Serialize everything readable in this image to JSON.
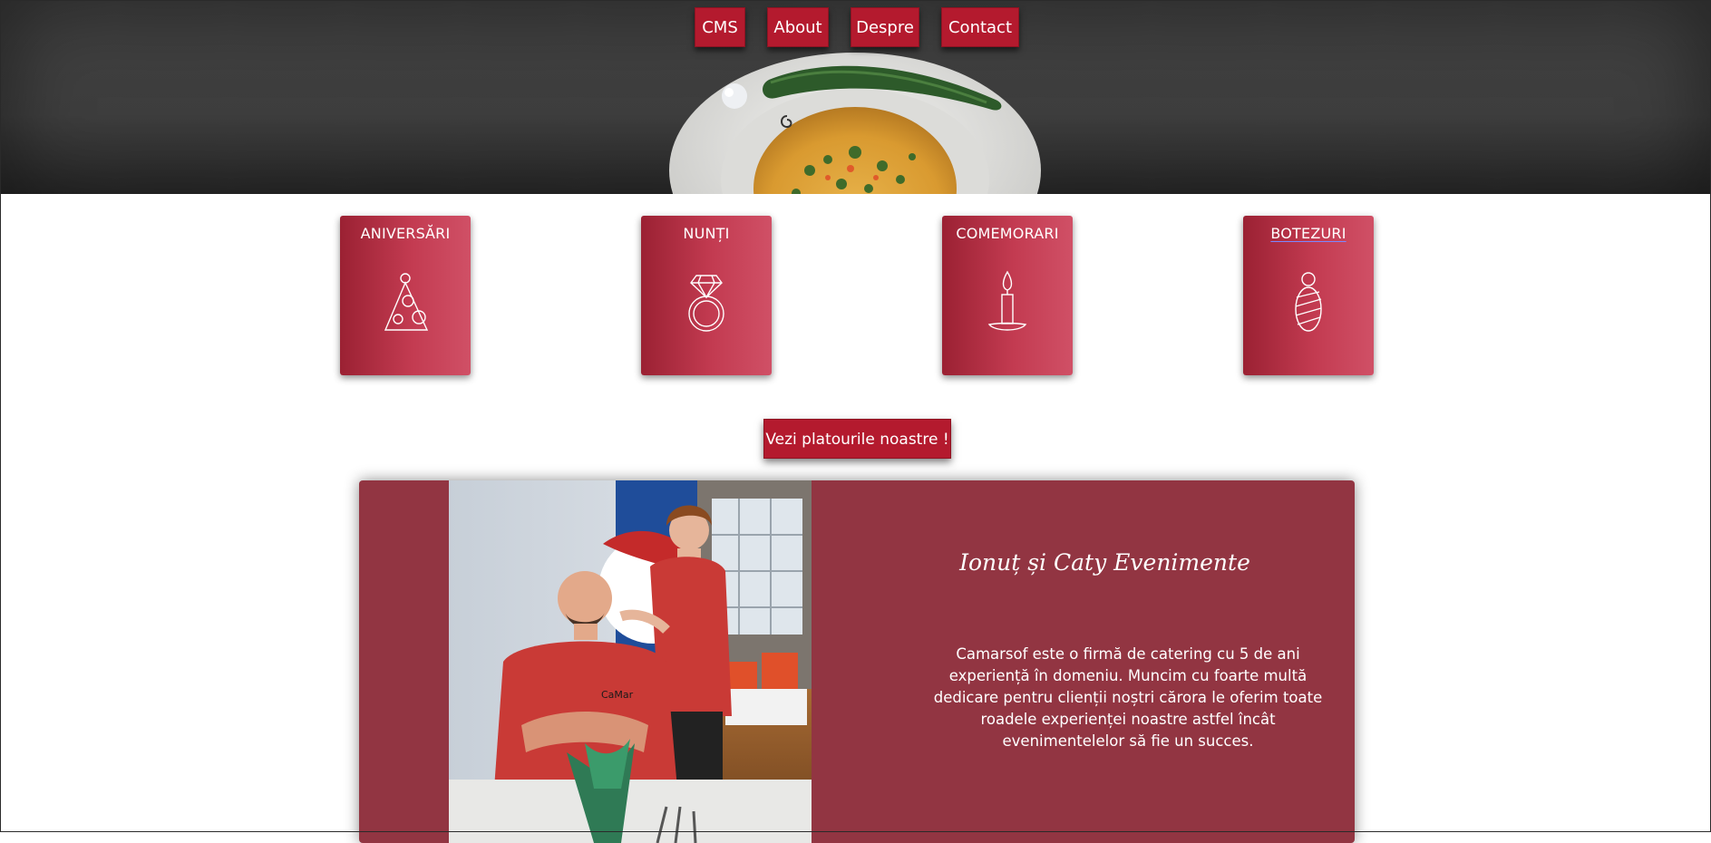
{
  "nav": {
    "items": [
      {
        "label": "CMS"
      },
      {
        "label": "About"
      },
      {
        "label": "Despre"
      },
      {
        "label": "Contact"
      }
    ]
  },
  "categories": [
    {
      "label": "ANIVERSĂRI",
      "icon": "party-hat-icon"
    },
    {
      "label": "NUNȚI",
      "icon": "ring-icon"
    },
    {
      "label": "COMEMORARI",
      "icon": "candle-icon"
    },
    {
      "label": "BOTEZURI",
      "icon": "baby-icon"
    }
  ],
  "cta": {
    "label": "Vezi platourile noastre !"
  },
  "about": {
    "title": "Ionuț și Caty Evenimente",
    "text": "Camarsof este o firmă de catering cu 5 de ani experiență în domeniu. Muncim cu foarte multă dedicare pentru clienții noștri cărora le oferim toate roadele experienței noastre astfel încât evenimentelelor să fie un succes.",
    "shirt_logo": "CaMar"
  },
  "colors": {
    "brand_red": "#b41a2e",
    "panel_red": "#923542",
    "header_gray": "#3d3d3d"
  }
}
